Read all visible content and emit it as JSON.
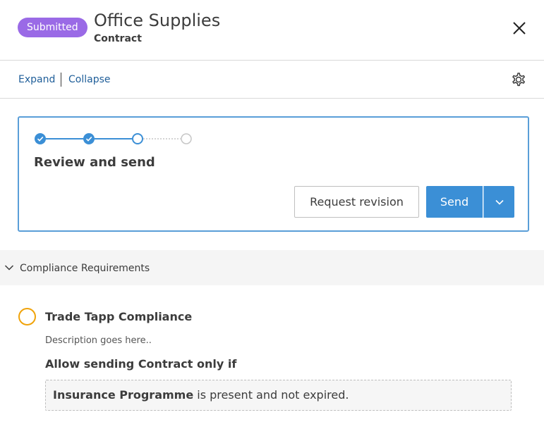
{
  "header": {
    "status": "Submitted",
    "title": "Office Supplies",
    "subtitle": "Contract"
  },
  "toolbar": {
    "expand": "Expand",
    "collapse": "Collapse"
  },
  "workflow": {
    "steps_total": 4,
    "steps_completed": 2,
    "current_step": 3,
    "step_title": "Review and send",
    "secondary_action": "Request revision",
    "primary_action": "Send"
  },
  "section": {
    "label": "Compliance Requirements",
    "expanded": true
  },
  "requirement": {
    "title": "Trade Tapp Compliance",
    "description": "Description goes here..",
    "rule_heading": "Allow sending Contract only if",
    "rule_doc": "Insurance Programme",
    "rule_text": " is present and not expired."
  },
  "colors": {
    "status_pill": "#9a6ae6",
    "primary": "#3b8fd6",
    "link": "#1f5e99",
    "pending": "#f0a30a",
    "card_border": "#5a9ed8"
  }
}
